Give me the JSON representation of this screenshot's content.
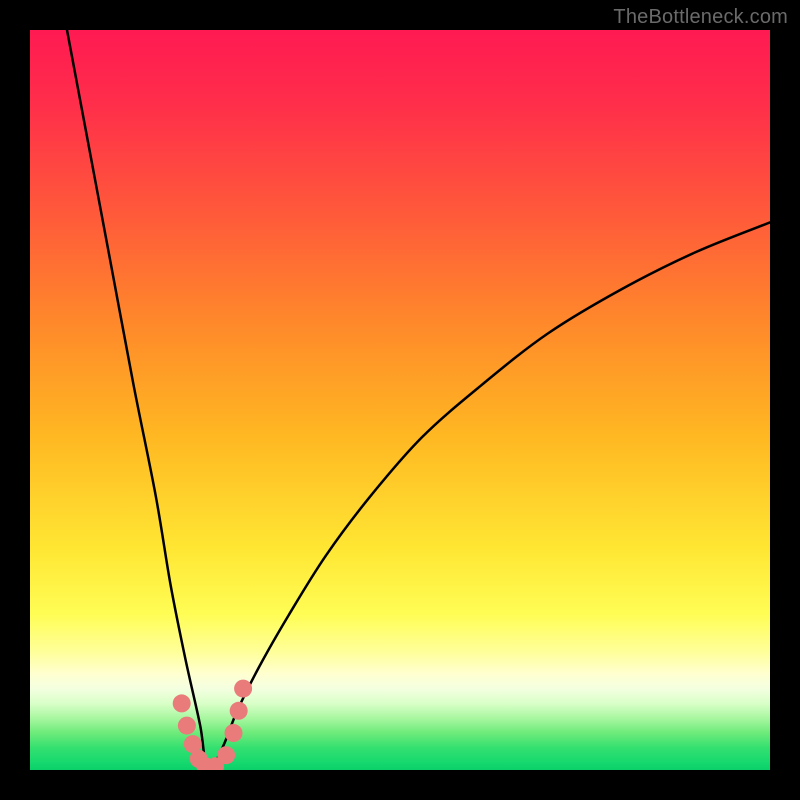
{
  "watermark": "TheBottleneck.com",
  "colors": {
    "background": "#000000",
    "curve": "#000000",
    "markers": "#e97b7b",
    "gradient_top": "#ff1a52",
    "gradient_bottom": "#0bd06a"
  },
  "chart_data": {
    "type": "line",
    "title": "",
    "xlabel": "",
    "ylabel": "",
    "xlim": [
      0,
      100
    ],
    "ylim": [
      0,
      100
    ],
    "grid": false,
    "legend": false,
    "notes": "V-shaped bottleneck curve over vertical red→yellow→green gradient. Apex x≈24, y≈0. Left branch reaches y≈100 at x≈5; right branch rises to y≈74 at x≈100. Salmon markers cluster near the apex.",
    "series": [
      {
        "name": "bottleneck-curve",
        "x": [
          5,
          8,
          11,
          14,
          17,
          19,
          21,
          23,
          24,
          26,
          28,
          31,
          35,
          40,
          46,
          53,
          61,
          70,
          80,
          90,
          100
        ],
        "y": [
          100,
          84,
          68,
          52,
          37,
          25,
          15,
          6,
          0,
          3,
          8,
          14,
          21,
          29,
          37,
          45,
          52,
          59,
          65,
          70,
          74
        ]
      },
      {
        "name": "marker-dots",
        "x": [
          20.5,
          21.2,
          22.0,
          22.8,
          23.7,
          25.0,
          26.5,
          27.5,
          28.2,
          28.8
        ],
        "y": [
          9.0,
          6.0,
          3.5,
          1.5,
          0.5,
          0.5,
          2.0,
          5.0,
          8.0,
          11.0
        ]
      }
    ]
  }
}
